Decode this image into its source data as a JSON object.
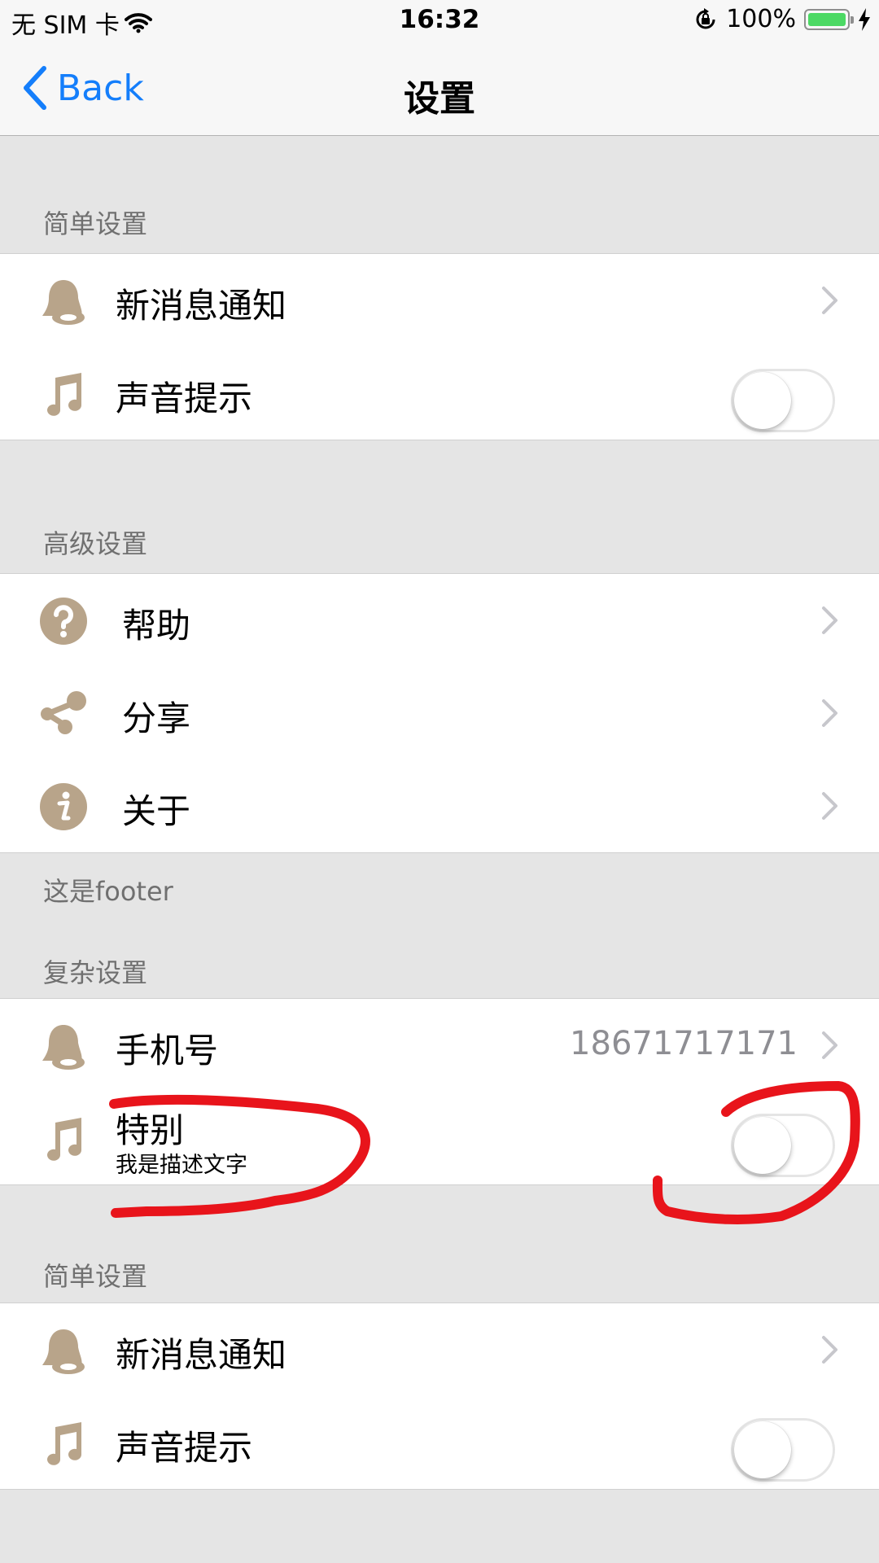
{
  "status_bar": {
    "carrier": "无 SIM 卡",
    "time": "16:32",
    "battery": "100%"
  },
  "nav": {
    "back_label": "Back",
    "title": "设置"
  },
  "sections": [
    {
      "header": "简单设置",
      "rows": [
        {
          "label": "新消息通知",
          "icon": "bell-icon",
          "accessory": "chevron"
        },
        {
          "label": "声音提示",
          "icon": "music-note-icon",
          "accessory": "switch",
          "switch_on": false
        }
      ]
    },
    {
      "header": "高级设置",
      "footer": "这是footer",
      "rows": [
        {
          "label": "帮助",
          "icon": "help-icon",
          "accessory": "chevron"
        },
        {
          "label": "分享",
          "icon": "share-icon",
          "accessory": "chevron"
        },
        {
          "label": "关于",
          "icon": "info-icon",
          "accessory": "chevron"
        }
      ]
    },
    {
      "header": "复杂设置",
      "rows": [
        {
          "label": "手机号",
          "icon": "bell-icon",
          "accessory": "chevron",
          "detail": "18671717171"
        },
        {
          "label": "特别",
          "subtitle": "我是描述文字",
          "icon": "music-note-icon",
          "accessory": "switch",
          "switch_on": false
        }
      ]
    },
    {
      "header": "简单设置",
      "rows": [
        {
          "label": "新消息通知",
          "icon": "bell-icon",
          "accessory": "chevron"
        },
        {
          "label": "声音提示",
          "icon": "music-note-icon",
          "accessory": "switch",
          "switch_on": false
        }
      ]
    }
  ],
  "colors": {
    "tint": "#147efb",
    "icon": "#b8a48a",
    "annotation": "#e8141b"
  }
}
